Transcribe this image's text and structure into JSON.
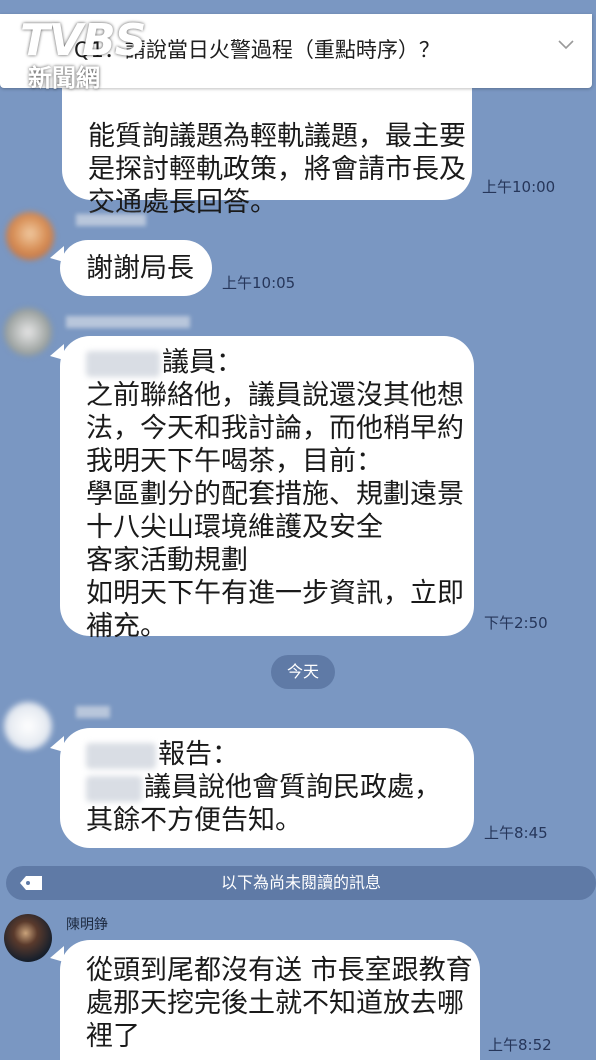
{
  "watermark": {
    "brand": "TVBS",
    "sub": "新聞網"
  },
  "pinned": {
    "question": "Q1：請說當日火警過程（重點時序）？"
  },
  "messages": [
    {
      "lines": [
        "能質詢議題為輕軌議題，最主要",
        "是探討輕軌政策，將會請市長及",
        "交通處長回答。"
      ],
      "time": "上午10:00"
    },
    {
      "text": "謝謝局長",
      "time": "上午10:05"
    },
    {
      "line1_suffix": "議員：",
      "lines": [
        "之前聯絡他，議員說還沒其他想",
        "法，今天和我討論，而他稍早約",
        "我明天下午喝茶，目前：",
        "學區劃分的配套措施、規劃遠景",
        "十八尖山環境維護及安全",
        "客家活動規劃",
        "如明天下午有進一步資訊，立即",
        "補充。"
      ],
      "time": "下午2:50"
    },
    {
      "line1_suffix": "報告：",
      "line2_suffix": "議員說他會質詢民政處，",
      "line3": "其餘不方便告知。",
      "time": "上午8:45"
    },
    {
      "sender": "陳明錚",
      "lines": [
        "從頭到尾都沒有送 市長室跟教育",
        "處那天挖完後土就不知道放去哪",
        "裡了"
      ],
      "time": "上午8:52"
    }
  ],
  "day_separator": "今天",
  "unread_notice": "以下為尚未閱讀的訊息",
  "icons": {
    "chevron": "chevron-down-icon",
    "unread": "tag-icon"
  },
  "colors": {
    "background": "#7a97c2",
    "bubble": "#ffffff",
    "pill": "#5f7aa6"
  }
}
